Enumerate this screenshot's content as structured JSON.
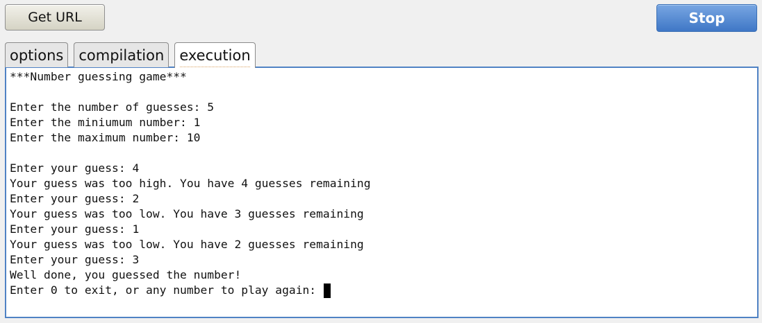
{
  "toolbar": {
    "get_url_label": "Get URL",
    "stop_label": "Stop"
  },
  "tabs": [
    {
      "label": "options",
      "active": false
    },
    {
      "label": "compilation",
      "active": false
    },
    {
      "label": "execution",
      "active": true
    }
  ],
  "console": {
    "output": "***Number guessing game***\n\nEnter the number of guesses: 5\nEnter the miniumum number: 1\nEnter the maximum number: 10\n\nEnter your guess: 4\nYour guess was too high. You have 4 guesses remaining\nEnter your guess: 2\nYour guess was too low. You have 3 guesses remaining\nEnter your guess: 1\nYour guess was too low. You have 2 guesses remaining\nEnter your guess: 3\nWell done, you guessed the number!\n",
    "prompt": "Enter 0 to exit, or any number to play again: "
  }
}
